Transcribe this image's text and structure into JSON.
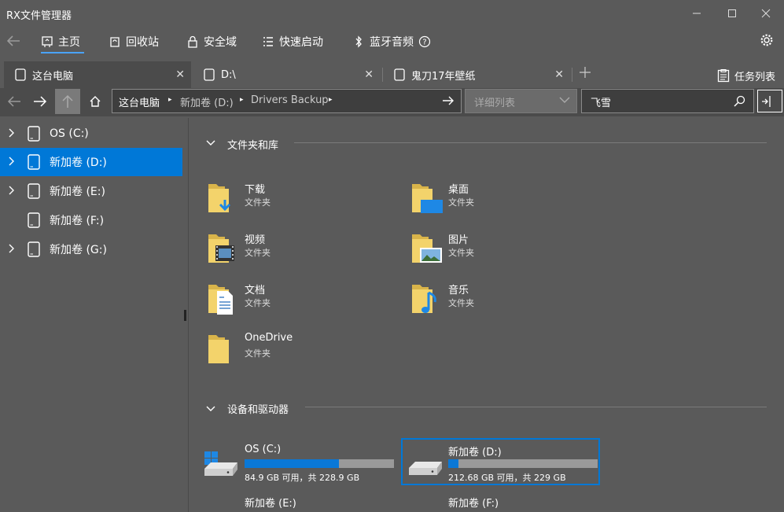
{
  "app": {
    "title": "RX文件管理器"
  },
  "ribbon": {
    "home": "主页",
    "recycle": "回收站",
    "security": "安全域",
    "quick_launch": "快速启动",
    "bluetooth": "蓝牙音频",
    "help_icon": "question-circle-icon",
    "settings_icon": "gear-icon"
  },
  "tabs": [
    {
      "label": "这台电脑",
      "active": true
    },
    {
      "label": "D:\\",
      "active": false
    },
    {
      "label": "鬼刀17年壁纸",
      "active": false
    }
  ],
  "task_list": "任务列表",
  "address": {
    "crumbs": [
      "这台电脑",
      "新加卷 (D:)",
      "Drivers Backup"
    ]
  },
  "view_mode": "详细列表",
  "search": {
    "value": "飞雪"
  },
  "sidebar": {
    "items": [
      {
        "label": "OS (C:)",
        "expandable": true,
        "selected": false
      },
      {
        "label": "新加卷 (D:)",
        "expandable": true,
        "selected": true
      },
      {
        "label": "新加卷 (E:)",
        "expandable": true,
        "selected": false
      },
      {
        "label": "新加卷 (F:)",
        "expandable": false,
        "selected": false
      },
      {
        "label": "新加卷 (G:)",
        "expandable": true,
        "selected": false
      }
    ]
  },
  "libraries": {
    "heading": "文件夹和库",
    "items": [
      {
        "name": "下载",
        "type": "文件夹",
        "icon": "download-folder-icon"
      },
      {
        "name": "桌面",
        "type": "文件夹",
        "icon": "desktop-folder-icon"
      },
      {
        "name": "视频",
        "type": "文件夹",
        "icon": "video-folder-icon"
      },
      {
        "name": "图片",
        "type": "文件夹",
        "icon": "pictures-folder-icon"
      },
      {
        "name": "文档",
        "type": "文件夹",
        "icon": "documents-folder-icon"
      },
      {
        "name": "音乐",
        "type": "文件夹",
        "icon": "music-folder-icon"
      },
      {
        "name": "OneDrive",
        "type": "文件夹",
        "icon": "onedrive-folder-icon"
      }
    ]
  },
  "devices": {
    "heading": "设备和驱动器",
    "items": [
      {
        "name": "OS (C:)",
        "info": "84.9 GB 可用，共 228.9 GB",
        "used_fraction": 0.63,
        "system": true
      },
      {
        "name": "新加卷 (D:)",
        "info": "212.68 GB 可用，共 229 GB",
        "used_fraction": 0.07,
        "selected": true
      },
      {
        "name": "新加卷 (E:)"
      },
      {
        "name": "新加卷 (F:)"
      }
    ]
  },
  "colors": {
    "accent": "#0078d7",
    "progress": "#0a78d7",
    "background": "#5a5a5a"
  }
}
